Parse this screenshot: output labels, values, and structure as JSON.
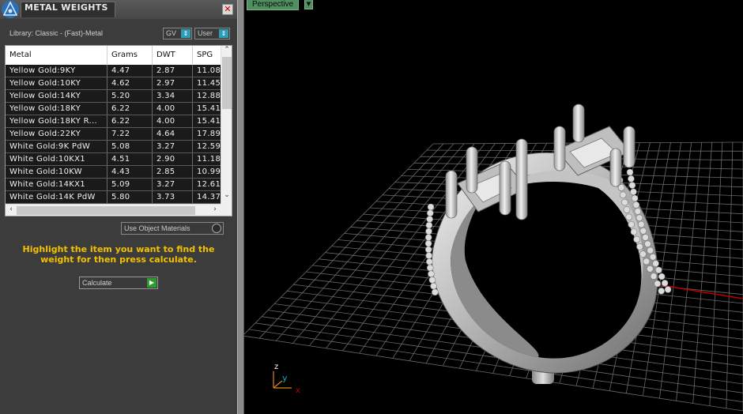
{
  "panel": {
    "title": "METAL WEIGHTS",
    "close_label": "✕",
    "library_label": "Library: Classic - (Fast)-Metal",
    "dropdown_gv": "GV",
    "dropdown_user": "User",
    "use_object_materials": "Use Object Materials",
    "instruction": "Highlight the item you want to find the weight for then press calculate.",
    "calculate_label": "Calculate"
  },
  "table": {
    "columns": [
      "Metal",
      "Grams",
      "DWT",
      "SPG"
    ],
    "rows": [
      [
        "Yellow Gold:9KY",
        "4.47",
        "2.87",
        "11.08"
      ],
      [
        "Yellow Gold:10KY",
        "4.62",
        "2.97",
        "11.45"
      ],
      [
        "Yellow Gold:14KY",
        "5.20",
        "3.34",
        "12.88"
      ],
      [
        "Yellow Gold:18KY",
        "6.22",
        "4.00",
        "15.41"
      ],
      [
        "Yellow Gold:18KY R...",
        "6.22",
        "4.00",
        "15.41"
      ],
      [
        "Yellow Gold:22KY",
        "7.22",
        "4.64",
        "17.89"
      ],
      [
        "White Gold:9K PdW",
        "5.08",
        "3.27",
        "12.59"
      ],
      [
        "White Gold:10KX1",
        "4.51",
        "2.90",
        "11.18"
      ],
      [
        "White Gold:10KW",
        "4.43",
        "2.85",
        "10.99"
      ],
      [
        "White Gold:14KX1",
        "5.09",
        "3.27",
        "12.61"
      ],
      [
        "White Gold:14K PdW",
        "5.80",
        "3.73",
        "14.37"
      ]
    ]
  },
  "viewport": {
    "label": "Perspective",
    "axis_z": "z",
    "axis_y": "y",
    "axis_x": "x"
  },
  "colors": {
    "instruction_text": "#f2c200",
    "viewport_label_bg": "#4f8f60",
    "x_axis": "#c00000",
    "y_axis": "#1fa6b0"
  },
  "icons": {
    "app_logo": "triangle-logo-icon",
    "close": "close-icon",
    "calculate": "play-arrow-icon"
  }
}
